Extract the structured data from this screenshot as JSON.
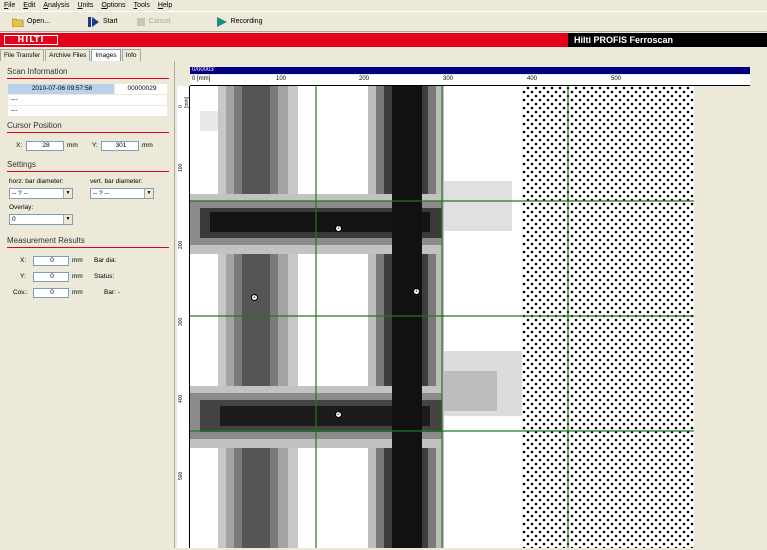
{
  "menu": [
    "File",
    "Edit",
    "Analysis",
    "Units",
    "Options",
    "Tools",
    "Help"
  ],
  "toolbar": {
    "open": "Open...",
    "start": "Start",
    "cancel": "Cancel",
    "recording": "Recording"
  },
  "brand": {
    "logo": "HILTI",
    "title": "Hilti PROFIS Ferroscan"
  },
  "tabs": [
    "File Transfer",
    "Archive Files",
    "Images",
    "Info"
  ],
  "active_tab": "Images",
  "scan_info": {
    "title": "Scan Information",
    "datetime": "2010-07-06 09:57:58",
    "id": "00000029",
    "line1": "---",
    "line2": "---"
  },
  "cursor": {
    "title": "Cursor Position",
    "x_label": "X:",
    "x_value": "28",
    "x_unit": "mm",
    "y_label": "Y:",
    "y_value": "301",
    "y_unit": "mm"
  },
  "settings": {
    "title": "Settings",
    "horz_label": "horz. bar diameter:",
    "horz_value": "-- ? --",
    "vert_label": "vert. bar diameter:",
    "vert_value": "-- ? --",
    "overlay_label": "Overlay:",
    "overlay_value": "0"
  },
  "results": {
    "title": "Measurement Results",
    "x_label": "X:",
    "x_value": "0",
    "x_unit": "mm",
    "y_label": "Y:",
    "y_value": "0",
    "y_unit": "mm",
    "cov_label": "Cov.:",
    "cov_value": "0",
    "cov_unit": "mm",
    "bar_dia_label": "Bar dia:",
    "status_label": "Status:",
    "bar_label": "Bar: -"
  },
  "plot": {
    "ruler_label": "0/00003",
    "hscale": [
      "0 [mm]",
      "100",
      "200",
      "300",
      "400",
      "500"
    ],
    "vscale": [
      "0 [mm]",
      "100",
      "200",
      "300",
      "400",
      "500"
    ],
    "markers": [
      "1",
      "2",
      "1",
      "2"
    ]
  }
}
